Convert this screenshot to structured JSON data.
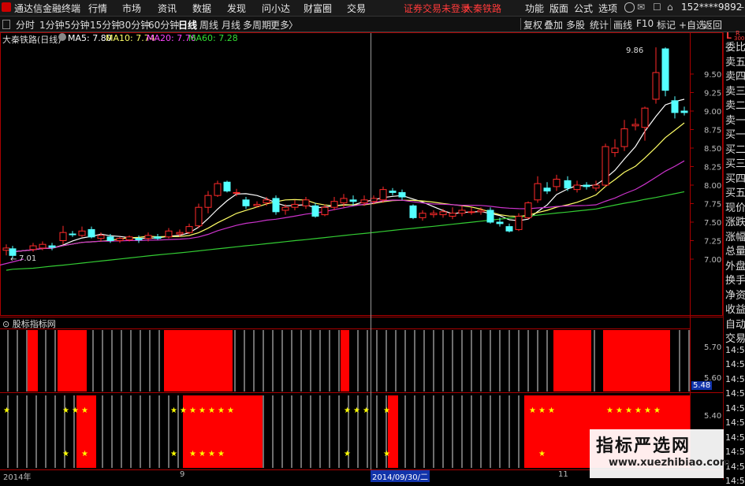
{
  "menubar": {
    "app_title": "通达信金融终端",
    "items": [
      "行情",
      "市场",
      "资讯",
      "数据",
      "发现",
      "问小达",
      "财富圈",
      "交易"
    ],
    "status": "证券交易未登录",
    "stock_name": "大秦铁路",
    "right_items": [
      "功能",
      "版面",
      "公式",
      "选项"
    ],
    "user": "152****9892",
    "window_controls": [
      "–",
      "□",
      "✕"
    ]
  },
  "toolbar": {
    "periods": [
      "分时",
      "1分钟",
      "5分钟",
      "15分钟",
      "30分钟",
      "60分钟",
      "日线",
      "周线",
      "月线",
      "多周期",
      "更多"
    ],
    "selected": "日线",
    "more_arrow": "〉",
    "right": [
      "复权",
      "叠加",
      "多股",
      "统计",
      "画线",
      "F10",
      "标记",
      "+自选",
      "返回"
    ]
  },
  "main_chart": {
    "title": "大秦铁路(日线)",
    "ma": [
      {
        "label": "MA5: 7.80",
        "color": "#ffffff"
      },
      {
        "label": "MA10: 7.74",
        "color": "#ffff66"
      },
      {
        "label": "MA20: 7.76",
        "color": "#ff44ff"
      },
      {
        "label": "MA60: 7.28",
        "color": "#33dd33"
      }
    ],
    "high_label": "9.86",
    "low_label": "7.01",
    "y_ticks": [
      "9.50",
      "9.25",
      "9.00",
      "8.75",
      "8.50",
      "8.25",
      "8.00",
      "7.75",
      "7.50",
      "7.25",
      "7.00"
    ]
  },
  "indicator": {
    "title": "股标指标网",
    "ticks1": [
      "5.70",
      "5.60"
    ],
    "ticks2": [
      "5.48",
      "5.40"
    ]
  },
  "time_axis": {
    "labels": [
      "2014年",
      "9",
      "2014/09/30/二",
      "11"
    ]
  },
  "right_panel": {
    "top_labels": [
      "L",
      "R",
      "300"
    ],
    "items": [
      "委比",
      "卖五",
      "卖四",
      "卖三",
      "卖二",
      "卖一",
      "买一",
      "买二",
      "买三",
      "买四",
      "买五",
      "现价",
      "涨跌",
      "涨幅",
      "总量",
      "外盘",
      "换手",
      "净资",
      "收益",
      "自动",
      "交易",
      "14:56",
      "14:56",
      "14:56",
      "14:56",
      "14:56",
      "14:56",
      "14:56",
      "14:56",
      "14:56",
      "14:56"
    ]
  },
  "watermark": {
    "line1": "指标严选网",
    "line2": "www.xuezhibiao.com"
  },
  "colors": {
    "up": "#ff2a2a",
    "down": "#54ffff",
    "ma5": "#ffffff",
    "ma10": "#ffff66",
    "ma20": "#cc33cc",
    "ma60": "#33cc33",
    "frame": "#aa0000"
  }
}
